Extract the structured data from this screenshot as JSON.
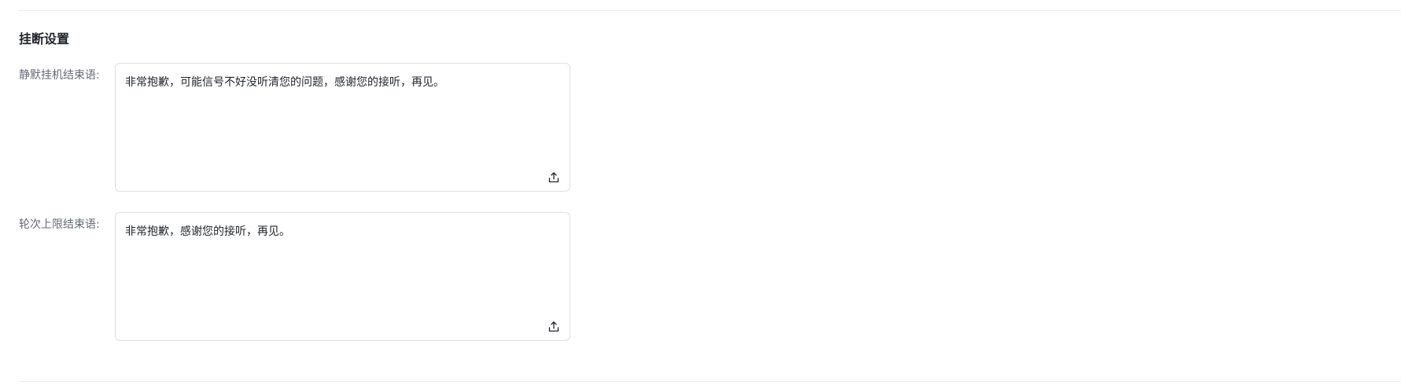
{
  "section": {
    "title": "挂断设置"
  },
  "fields": [
    {
      "label": "静默挂机结束语:",
      "value": "非常抱歉，可能信号不好没听清您的问题，感谢您的接听，再见。",
      "icon": "upload-icon"
    },
    {
      "label": "轮次上限结束语:",
      "value": "非常抱歉，感谢您的接听，再见。",
      "icon": "upload-icon"
    }
  ],
  "colors": {
    "border": "#dee0e3",
    "label": "#646a73",
    "text": "#1f2329",
    "divider": "#ebedf0"
  }
}
